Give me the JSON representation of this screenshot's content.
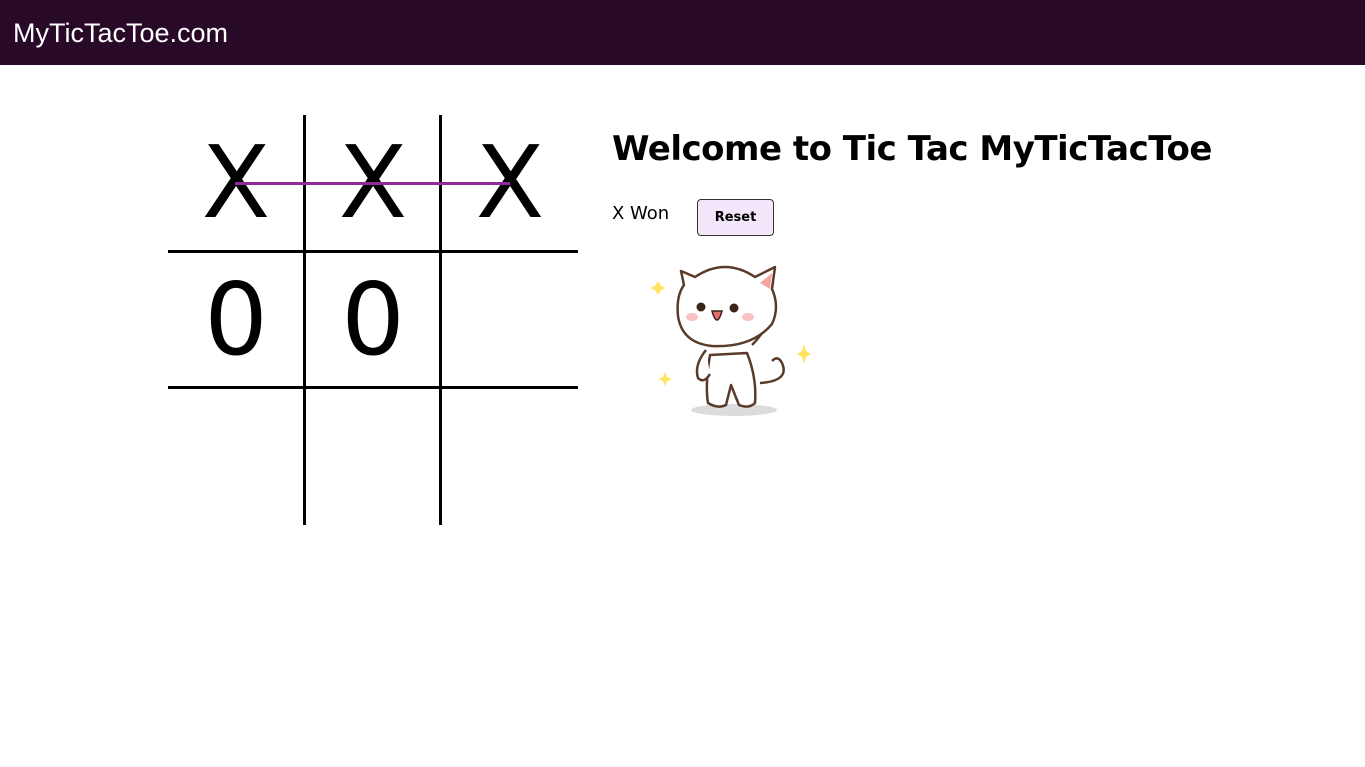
{
  "site": {
    "brand": "MyTicTacToe.com"
  },
  "board": {
    "cells": [
      "X",
      "X",
      "X",
      "0",
      "0",
      "",
      "",
      "",
      ""
    ],
    "winning_row": "top",
    "win_line_color": "#8e2a9c"
  },
  "panel": {
    "title": "Welcome to Tic Tac MyTicTacToe",
    "status": "X Won",
    "reset_label": "Reset"
  },
  "colors": {
    "header_bg": "#280a28",
    "reset_bg": "#f4e6fb"
  },
  "icons": {
    "celebration": "dancing-cat-sticker"
  }
}
